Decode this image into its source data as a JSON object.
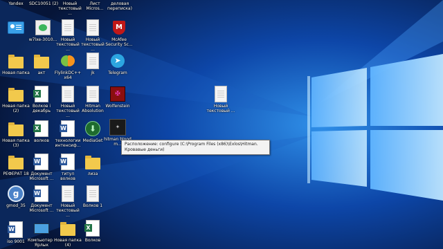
{
  "desktop": {
    "top_row_labels": [
      "Yandex",
      "SDC10051 (2)",
      "Новый текстовый ...",
      "Лист Micros...",
      "деловая переписка)"
    ],
    "icons": {
      "c1": [
        "",
        "Новая папка",
        "Новая папка (2)",
        "Новая папка (3)",
        "РЕФЕРАТ 18",
        "gmod_35",
        "iso 9001"
      ],
      "c2": [
        "w7lxe-3010...",
        "акт",
        "Волков i декабрь",
        "волков",
        "Документ Microsoft ...",
        "Документ Microsoft ...",
        "Компьютер - Ярлык"
      ],
      "c3": [
        "Новый текстовый ...",
        "FlylinkDC++ x64",
        "Новый текстовый ...",
        "технологии интенсиф...",
        "титул волков",
        "Новый текстовый ...",
        "Новая папка (4)"
      ],
      "c4": [
        "Новый текстовый ...",
        "jk",
        "Hitman Absolution",
        "MediaGet",
        "лиза",
        "Волков 1",
        "Волков"
      ],
      "c5": [
        "McAfee Security Sc...",
        "Telegram",
        "Wolfenstein",
        "hitman blood m..."
      ],
      "desk_doc": "Новый текстовый ..."
    },
    "tooltip_text": "Расположение: configure (C:\\Program Files (x86)\\Exlos\\Hitman. Кровавые деньги)"
  },
  "colors": {
    "wallpaper_dark": "#061538",
    "wallpaper_light": "#2f8fe8",
    "window_glow": "#9fd7ff"
  }
}
